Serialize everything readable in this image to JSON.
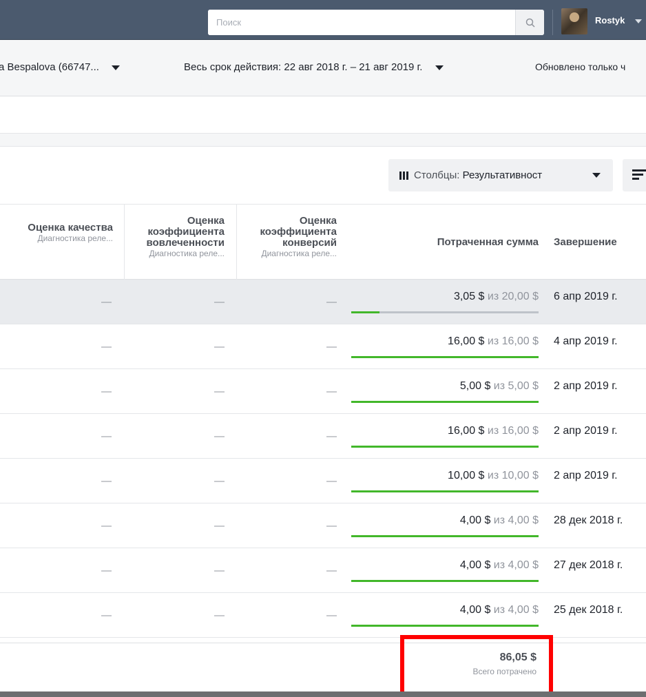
{
  "topbar": {
    "search_placeholder": "Поиск",
    "username": "Rostyk"
  },
  "filters": {
    "account": "a Bespalova (66747...",
    "date_range": "Весь срок действия: 22 авг 2018 г. – 21 авг 2019 г.",
    "updated": "Обновлено только ч"
  },
  "toolbar": {
    "columns_label": "Столбцы:",
    "columns_value": "Результативност"
  },
  "table": {
    "headers": {
      "quality": "Оценка качества",
      "engagement": "Оценка коэффициента вовлеченности",
      "conversion": "Оценка коэффициента конверсий",
      "diagnostic_sub": "Диагностика реле...",
      "spent": "Потраченная сумма",
      "end": "Завершение"
    },
    "rows": [
      {
        "quality": "—",
        "engagement": "—",
        "conversion": "—",
        "spent": "3,05 $",
        "of_text": "из 20,00 $",
        "progress": 0.1525,
        "end": "6 апр 2019 г."
      },
      {
        "quality": "—",
        "engagement": "—",
        "conversion": "—",
        "spent": "16,00 $",
        "of_text": "из 16,00 $",
        "progress": 1,
        "end": "4 апр 2019 г."
      },
      {
        "quality": "—",
        "engagement": "—",
        "conversion": "—",
        "spent": "5,00 $",
        "of_text": "из 5,00 $",
        "progress": 1,
        "end": "2 апр 2019 г."
      },
      {
        "quality": "—",
        "engagement": "—",
        "conversion": "—",
        "spent": "16,00 $",
        "of_text": "из 16,00 $",
        "progress": 1,
        "end": "2 апр 2019 г."
      },
      {
        "quality": "—",
        "engagement": "—",
        "conversion": "—",
        "spent": "10,00 $",
        "of_text": "из 10,00 $",
        "progress": 1,
        "end": "2 апр 2019 г."
      },
      {
        "quality": "—",
        "engagement": "—",
        "conversion": "—",
        "spent": "4,00 $",
        "of_text": "из 4,00 $",
        "progress": 1,
        "end": "28 дек 2018 г."
      },
      {
        "quality": "—",
        "engagement": "—",
        "conversion": "—",
        "spent": "4,00 $",
        "of_text": "из 4,00 $",
        "progress": 1,
        "end": "27 дек 2018 г."
      },
      {
        "quality": "—",
        "engagement": "—",
        "conversion": "—",
        "spent": "4,00 $",
        "of_text": "из 4,00 $",
        "progress": 1,
        "end": "25 дек 2018 г."
      }
    ]
  },
  "footer": {
    "total_amount": "86,05 $",
    "total_label": "Всего потрачено"
  },
  "colors": {
    "topbar": "#4b5a6e",
    "progress_fill": "#42b72a",
    "progress_track": "#bec3c9",
    "highlight_box": "#ff0000"
  },
  "icons": {
    "search": "search-icon",
    "user_menu": "chevron-down-icon",
    "columns": "columns-icon",
    "breakdown": "breakdown-icon"
  }
}
